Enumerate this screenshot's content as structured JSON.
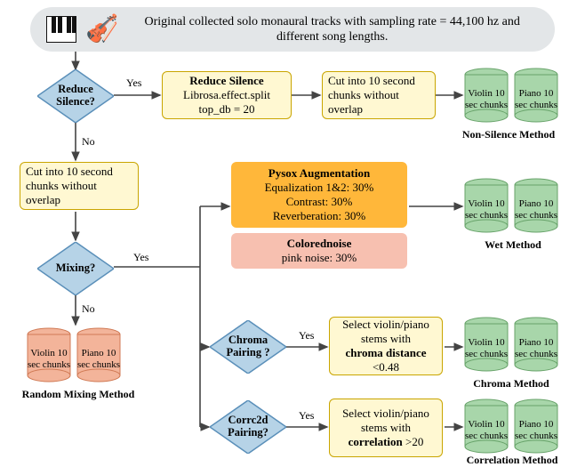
{
  "header": {
    "text": "Original collected solo monaural tracks with sampling rate = 44,100 hz and different song lengths.",
    "icons": [
      "piano-icon",
      "violin-icon"
    ]
  },
  "decisions": {
    "reduce_silence": {
      "label": "Reduce Silence?",
      "yes": "Yes",
      "no": "No"
    },
    "mixing": {
      "label": "Mixing?",
      "yes": "Yes",
      "no": "No"
    },
    "chroma": {
      "label": "Chroma Pairing ?",
      "yes": "Yes"
    },
    "corr2d": {
      "label": "Corrc2d Pairing?",
      "yes": "Yes"
    }
  },
  "steps": {
    "reduce_silence_box": {
      "title": "Reduce Silence",
      "line1": "Librosa.effect.split",
      "line2": "top_db = 20"
    },
    "cut_a": {
      "text": "Cut into 10 second chunks without overlap"
    },
    "cut_b": {
      "text": "Cut into 10 second chunks without overlap"
    },
    "pysox": {
      "title": "Pysox Augmentation",
      "lines": [
        "Equalization 1&2: 30%",
        "Contrast: 30%",
        "Reverberation: 30%"
      ]
    },
    "colored": {
      "title": "Colorednoise",
      "line": "pink noise: 30%"
    },
    "chroma_select": {
      "text": "Select violin/piano stems with",
      "bold": "chroma distance",
      "tail": " <0.48"
    },
    "corr_select": {
      "text": "Select violin/piano stems with",
      "bold": "correlation",
      "tail": " >20"
    }
  },
  "outputs": {
    "non_silence": {
      "violin": "Violin 10 sec chunks",
      "piano": "Piano 10 sec chunks",
      "label": "Non-Silence Method"
    },
    "wet": {
      "violin": "Violin 10 sec chunks",
      "piano": "Piano 10 sec chunks",
      "label": "Wet Method"
    },
    "random": {
      "violin": "Violin 10 sec chunks",
      "piano": "Piano 10 sec chunks",
      "label": "Random Mixing Method"
    },
    "chroma_out": {
      "violin": "Violin 10 sec chunks",
      "piano": "Piano 10 sec chunks",
      "label": "Chroma  Method"
    },
    "corr_out": {
      "violin": "Violin 10 sec chunks",
      "piano": "Piano 10 sec chunks",
      "label": "Correlation Method"
    }
  },
  "chart_data": {
    "type": "flowchart",
    "start": "Original collected solo monaural tracks (sampling rate = 44,100 hz, different song lengths)",
    "nodes": [
      {
        "id": "reduce_silence_q",
        "type": "decision",
        "label": "Reduce Silence?"
      },
      {
        "id": "reduce_silence_op",
        "type": "process",
        "label": "Reduce Silence: Librosa.effect.split top_db=20"
      },
      {
        "id": "cut_a",
        "type": "process",
        "label": "Cut into 10 second chunks without overlap"
      },
      {
        "id": "non_silence_out",
        "type": "data",
        "label": "Violin/Piano 10 sec chunks — Non-Silence Method"
      },
      {
        "id": "cut_b",
        "type": "process",
        "label": "Cut into 10 second chunks without overlap"
      },
      {
        "id": "mixing_q",
        "type": "decision",
        "label": "Mixing?"
      },
      {
        "id": "random_out",
        "type": "data",
        "label": "Violin/Piano 10 sec chunks — Random Mixing Method"
      },
      {
        "id": "pysox",
        "type": "process",
        "label": "Pysox Augmentation: Equalization 1&2 30%, Contrast 30%, Reverberation 30%"
      },
      {
        "id": "colored",
        "type": "process",
        "label": "Colorednoise: pink noise 30%"
      },
      {
        "id": "wet_out",
        "type": "data",
        "label": "Violin/Piano 10 sec chunks — Wet Method"
      },
      {
        "id": "chroma_q",
        "type": "decision",
        "label": "Chroma Pairing?"
      },
      {
        "id": "chroma_sel",
        "type": "process",
        "label": "Select violin/piano stems with chroma distance <0.48"
      },
      {
        "id": "chroma_out",
        "type": "data",
        "label": "Violin/Piano 10 sec chunks — Chroma Method"
      },
      {
        "id": "corr_q",
        "type": "decision",
        "label": "Corrc2d Pairing?"
      },
      {
        "id": "corr_sel",
        "type": "process",
        "label": "Select violin/piano stems with correlation >20"
      },
      {
        "id": "corr_out",
        "type": "data",
        "label": "Violin/Piano 10 sec chunks — Correlation Method"
      }
    ],
    "edges": [
      {
        "from": "start",
        "to": "reduce_silence_q"
      },
      {
        "from": "reduce_silence_q",
        "to": "reduce_silence_op",
        "label": "Yes"
      },
      {
        "from": "reduce_silence_op",
        "to": "cut_a"
      },
      {
        "from": "cut_a",
        "to": "non_silence_out"
      },
      {
        "from": "reduce_silence_q",
        "to": "cut_b",
        "label": "No"
      },
      {
        "from": "cut_b",
        "to": "mixing_q"
      },
      {
        "from": "mixing_q",
        "to": "random_out",
        "label": "No"
      },
      {
        "from": "mixing_q",
        "to": "pysox",
        "label": "Yes"
      },
      {
        "from": "pysox",
        "to": "colored"
      },
      {
        "from": "colored",
        "to": "wet_out"
      },
      {
        "from": "mixing_q",
        "to": "chroma_q",
        "label": "Yes"
      },
      {
        "from": "chroma_q",
        "to": "chroma_sel",
        "label": "Yes"
      },
      {
        "from": "chroma_sel",
        "to": "chroma_out"
      },
      {
        "from": "mixing_q",
        "to": "corr_q",
        "label": "Yes"
      },
      {
        "from": "corr_q",
        "to": "corr_sel",
        "label": "Yes"
      },
      {
        "from": "corr_sel",
        "to": "corr_out"
      }
    ]
  }
}
